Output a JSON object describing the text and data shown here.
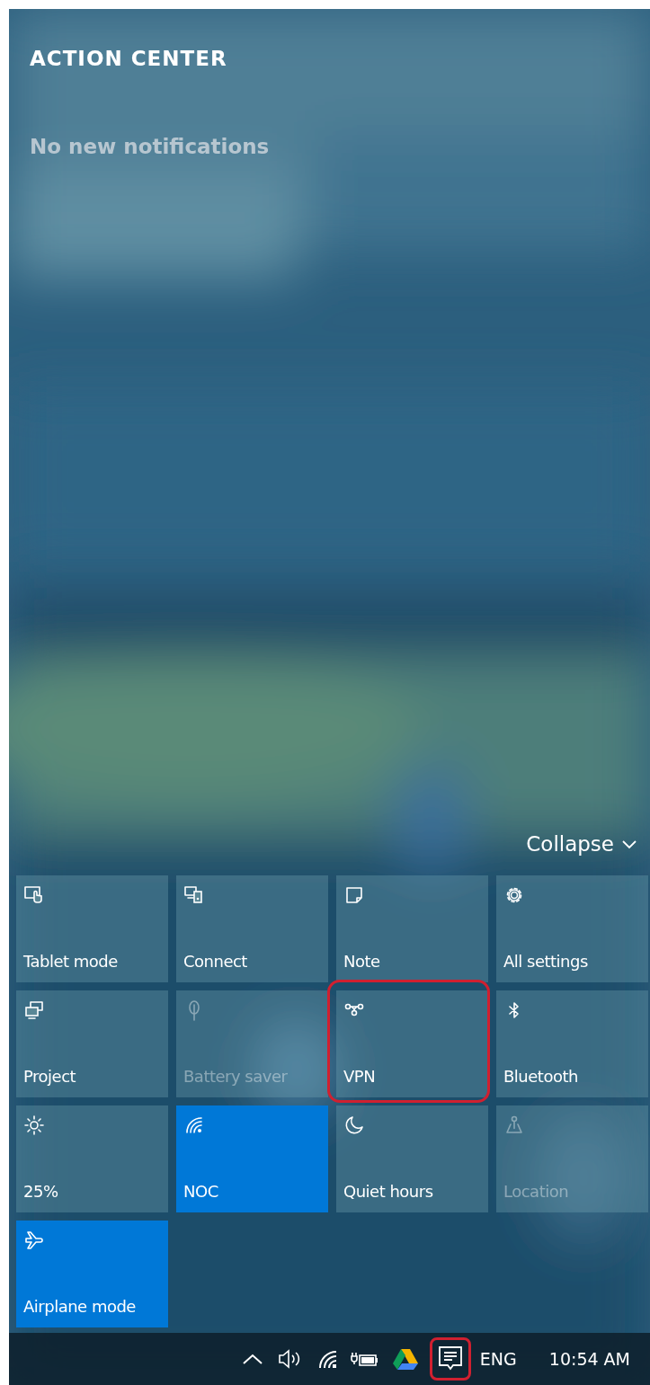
{
  "title": "ACTION CENTER",
  "notifications_message": "No new notifications",
  "collapse": {
    "label": "Collapse"
  },
  "quick_actions": [
    {
      "label": "Tablet mode",
      "on": false,
      "disabled": false,
      "highlighted": false
    },
    {
      "label": "Connect",
      "on": false,
      "disabled": false,
      "highlighted": false
    },
    {
      "label": "Note",
      "on": false,
      "disabled": false,
      "highlighted": false
    },
    {
      "label": "All settings",
      "on": false,
      "disabled": false,
      "highlighted": false
    },
    {
      "label": "Project",
      "on": false,
      "disabled": false,
      "highlighted": false
    },
    {
      "label": "Battery saver",
      "on": false,
      "disabled": true,
      "highlighted": false
    },
    {
      "label": "VPN",
      "on": false,
      "disabled": false,
      "highlighted": true
    },
    {
      "label": "Bluetooth",
      "on": false,
      "disabled": false,
      "highlighted": false
    },
    {
      "label": "25%",
      "on": false,
      "disabled": false,
      "highlighted": false
    },
    {
      "label": "NOC",
      "on": true,
      "disabled": false,
      "highlighted": false
    },
    {
      "label": "Quiet hours",
      "on": false,
      "disabled": false,
      "highlighted": false
    },
    {
      "label": "Location",
      "on": false,
      "disabled": true,
      "highlighted": false
    },
    {
      "label": "Airplane mode",
      "on": true,
      "disabled": false,
      "highlighted": false
    }
  ],
  "taskbar": {
    "action_center_button": {
      "highlighted": true
    },
    "language": "ENG",
    "time": "10:54 AM"
  }
}
